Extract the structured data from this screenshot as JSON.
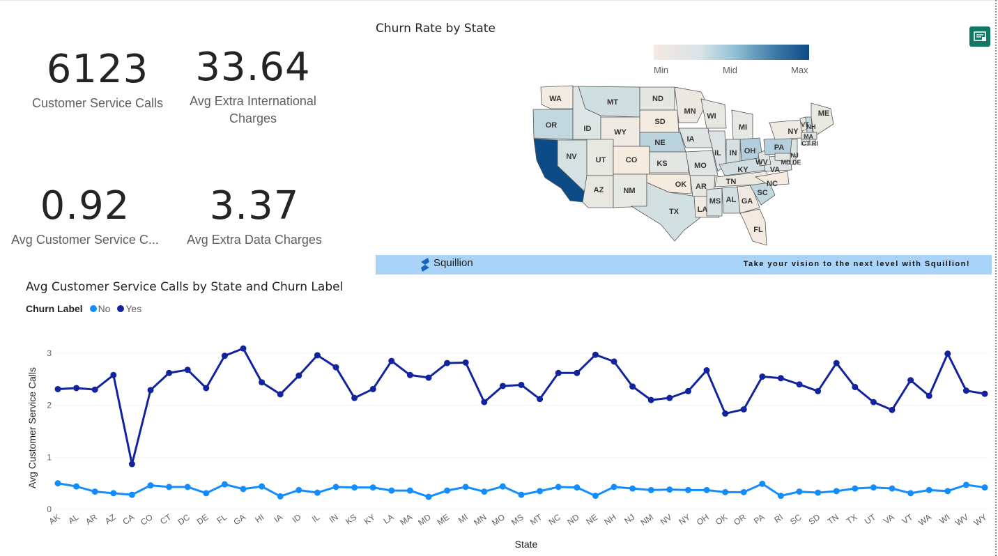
{
  "kpis": [
    {
      "value": "6123",
      "label": "Customer Service Calls"
    },
    {
      "value": "33.64",
      "label": "Avg Extra International Charges"
    },
    {
      "value": "0.92",
      "label": "Avg Customer Service C..."
    },
    {
      "value": "3.37",
      "label": "Avg Extra Data Charges"
    }
  ],
  "map": {
    "title": "Churn Rate by State",
    "legend": {
      "min": "Min",
      "mid": "Mid",
      "max": "Max"
    },
    "colors": {
      "low": "#f4e9df",
      "mid": "#98c5d7",
      "high": "#0d4b87"
    }
  },
  "banner": {
    "brand": "Squillion",
    "tagline": "Take your vision to the next level with Squillion!",
    "background": "#a9d4f7"
  },
  "line_chart_title": "Avg Customer Service Calls by State and Churn Label",
  "legend": {
    "title": "Churn Label",
    "items": [
      {
        "label": "No",
        "color": "#118dff"
      },
      {
        "label": "Yes",
        "color": "#12239e"
      }
    ]
  },
  "chart_data": {
    "type": "line",
    "xlabel": "State",
    "ylabel": "Avg Customer Service Calls",
    "ylim": [
      0,
      3.1
    ],
    "yticks": [
      0,
      1,
      2,
      3
    ],
    "grid": true,
    "categories": [
      "AK",
      "AL",
      "AR",
      "AZ",
      "CA",
      "CO",
      "CT",
      "DC",
      "DE",
      "FL",
      "GA",
      "HI",
      "IA",
      "ID",
      "IL",
      "IN",
      "KS",
      "KY",
      "LA",
      "MA",
      "MD",
      "ME",
      "MI",
      "MN",
      "MO",
      "MS",
      "MT",
      "NC",
      "ND",
      "NE",
      "NH",
      "NJ",
      "NM",
      "NV",
      "NY",
      "OH",
      "OK",
      "OR",
      "PA",
      "RI",
      "SC",
      "SD",
      "TN",
      "TX",
      "UT",
      "VA",
      "VT",
      "WA",
      "WI",
      "WV",
      "WY"
    ],
    "series": [
      {
        "name": "No",
        "color": "#118dff",
        "values": [
          0.5,
          0.44,
          0.34,
          0.31,
          0.28,
          0.46,
          0.43,
          0.43,
          0.31,
          0.48,
          0.39,
          0.44,
          0.25,
          0.37,
          0.32,
          0.43,
          0.42,
          0.42,
          0.36,
          0.36,
          0.24,
          0.36,
          0.43,
          0.34,
          0.44,
          0.28,
          0.35,
          0.43,
          0.42,
          0.26,
          0.43,
          0.4,
          0.37,
          0.38,
          0.37,
          0.37,
          0.33,
          0.33,
          0.49,
          0.26,
          0.34,
          0.32,
          0.35,
          0.4,
          0.42,
          0.4,
          0.31,
          0.37,
          0.35,
          0.47,
          0.42
        ]
      },
      {
        "name": "Yes",
        "color": "#12239e",
        "values": [
          2.31,
          2.33,
          2.3,
          2.58,
          0.87,
          2.29,
          2.62,
          2.68,
          2.33,
          2.95,
          3.09,
          2.44,
          2.21,
          2.57,
          2.96,
          2.73,
          2.14,
          2.31,
          2.85,
          2.58,
          2.53,
          2.81,
          2.82,
          2.06,
          2.37,
          2.39,
          2.12,
          2.62,
          2.62,
          2.97,
          2.84,
          2.36,
          2.1,
          2.14,
          2.27,
          2.67,
          1.84,
          1.92,
          2.55,
          2.52,
          2.4,
          2.27,
          2.81,
          2.35,
          2.06,
          1.91,
          2.48,
          2.18,
          2.99,
          2.28,
          2.22
        ]
      }
    ]
  }
}
